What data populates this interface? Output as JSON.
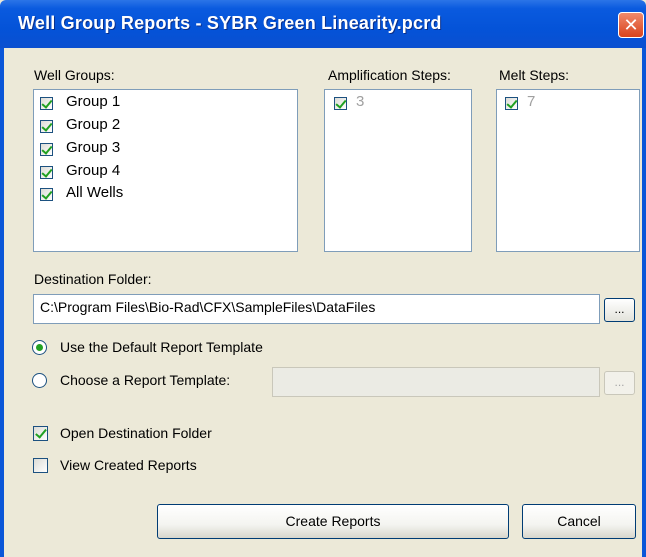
{
  "window": {
    "title": "Well Group Reports - SYBR Green Linearity.pcrd",
    "close_label": "✕"
  },
  "well_groups": {
    "label": "Well Groups:",
    "items": [
      {
        "label": "Group 1",
        "checked": true
      },
      {
        "label": "Group 2",
        "checked": true
      },
      {
        "label": "Group 3",
        "checked": true
      },
      {
        "label": "Group 4",
        "checked": true
      },
      {
        "label": "All Wells",
        "checked": true
      }
    ]
  },
  "amplification_steps": {
    "label": "Amplification Steps:",
    "items": [
      {
        "label": "3",
        "checked": true
      }
    ]
  },
  "melt_steps": {
    "label": "Melt Steps:",
    "items": [
      {
        "label": "7",
        "checked": true
      }
    ]
  },
  "destination": {
    "label": "Destination Folder:",
    "value": "C:\\Program Files\\Bio-Rad\\CFX\\SampleFiles\\DataFiles",
    "browse_label": "..."
  },
  "template_options": {
    "default_label": "Use the Default Report Template",
    "choose_label": "Choose a Report Template:",
    "selected": "default",
    "template_value": "",
    "browse_label": "..."
  },
  "options": {
    "open_folder_label": "Open Destination Folder",
    "open_folder_checked": true,
    "view_reports_label": "View Created Reports",
    "view_reports_checked": false
  },
  "buttons": {
    "create_label": "Create Reports",
    "cancel_label": "Cancel"
  }
}
